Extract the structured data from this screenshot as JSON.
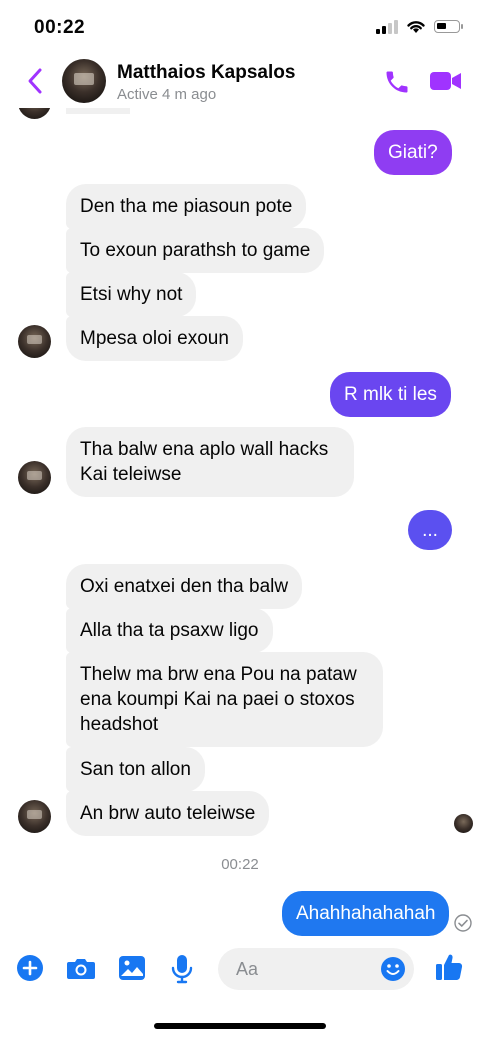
{
  "status_bar": {
    "time": "00:22"
  },
  "header": {
    "name": "Matthaios Kapsalos",
    "status": "Active 4 m ago"
  },
  "colors": {
    "accent": "#a033ff",
    "outgoing_purple": "#8f3df2",
    "outgoing_indigo": "#5b50f0",
    "outgoing_blue": "#1f78f0",
    "incoming_bg": "#f0f0f0",
    "icon_blue": "#1877f2"
  },
  "messages": [
    {
      "from": "me",
      "text": "Giati?"
    },
    {
      "from": "them",
      "text": "Den tha me piasoun pote"
    },
    {
      "from": "them",
      "text": "To exoun parathsh to game"
    },
    {
      "from": "them",
      "text": "Etsi why not"
    },
    {
      "from": "them",
      "text": "Mpesa oloi exoun"
    },
    {
      "from": "me",
      "text": "R mlk ti les"
    },
    {
      "from": "them",
      "lines": [
        "Tha balw ena aplo wall hacks",
        "Kai teleiwse"
      ]
    },
    {
      "from": "me",
      "text": "..."
    },
    {
      "from": "them",
      "text": "Oxi enatxei den tha balw"
    },
    {
      "from": "them",
      "text": "Alla tha ta psaxw ligo"
    },
    {
      "from": "them",
      "lines": [
        "Thelw ma brw ena Pou na pataw",
        "ena koumpi Kai na paei o stoxos",
        "headshot"
      ]
    },
    {
      "from": "them",
      "text": "San ton allon"
    },
    {
      "from": "them",
      "text": "An brw auto teleiwse"
    },
    {
      "from": "me",
      "text": "Ahahhahahahah"
    }
  ],
  "timestamp": "00:22",
  "composer": {
    "placeholder": "Aa",
    "icons": [
      "plus-icon",
      "camera-icon",
      "gallery-icon",
      "microphone-icon",
      "emoji-icon",
      "thumbs-up-icon"
    ]
  }
}
